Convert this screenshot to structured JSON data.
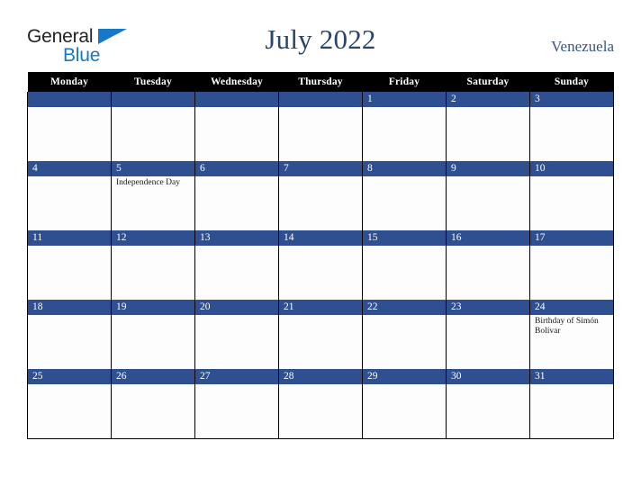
{
  "brand": {
    "line1": "General",
    "line2": "Blue",
    "triangle_color": "#1878c8",
    "text_color": "#232323"
  },
  "header": {
    "title": "July 2022",
    "country": "Venezuela",
    "title_color": "#2b4469",
    "country_color": "#3a5580"
  },
  "theme": {
    "daybar_color": "#2e5090",
    "header_row_bg": "#000000",
    "header_row_text": "#ffffff",
    "cell_bg": "#fdfdfd",
    "border_color": "#000000"
  },
  "weekday_headers": [
    "Monday",
    "Tuesday",
    "Wednesday",
    "Thursday",
    "Friday",
    "Saturday",
    "Sunday"
  ],
  "weeks": [
    [
      {
        "day": "",
        "events": []
      },
      {
        "day": "",
        "events": []
      },
      {
        "day": "",
        "events": []
      },
      {
        "day": "",
        "events": []
      },
      {
        "day": "1",
        "events": []
      },
      {
        "day": "2",
        "events": []
      },
      {
        "day": "3",
        "events": []
      }
    ],
    [
      {
        "day": "4",
        "events": []
      },
      {
        "day": "5",
        "events": [
          "Independence Day"
        ]
      },
      {
        "day": "6",
        "events": []
      },
      {
        "day": "7",
        "events": []
      },
      {
        "day": "8",
        "events": []
      },
      {
        "day": "9",
        "events": []
      },
      {
        "day": "10",
        "events": []
      }
    ],
    [
      {
        "day": "11",
        "events": []
      },
      {
        "day": "12",
        "events": []
      },
      {
        "day": "13",
        "events": []
      },
      {
        "day": "14",
        "events": []
      },
      {
        "day": "15",
        "events": []
      },
      {
        "day": "16",
        "events": []
      },
      {
        "day": "17",
        "events": []
      }
    ],
    [
      {
        "day": "18",
        "events": []
      },
      {
        "day": "19",
        "events": []
      },
      {
        "day": "20",
        "events": []
      },
      {
        "day": "21",
        "events": []
      },
      {
        "day": "22",
        "events": []
      },
      {
        "day": "23",
        "events": []
      },
      {
        "day": "24",
        "events": [
          "Birthday of Simón Bolívar"
        ]
      }
    ],
    [
      {
        "day": "25",
        "events": []
      },
      {
        "day": "26",
        "events": []
      },
      {
        "day": "27",
        "events": []
      },
      {
        "day": "28",
        "events": []
      },
      {
        "day": "29",
        "events": []
      },
      {
        "day": "30",
        "events": []
      },
      {
        "day": "31",
        "events": []
      }
    ]
  ]
}
